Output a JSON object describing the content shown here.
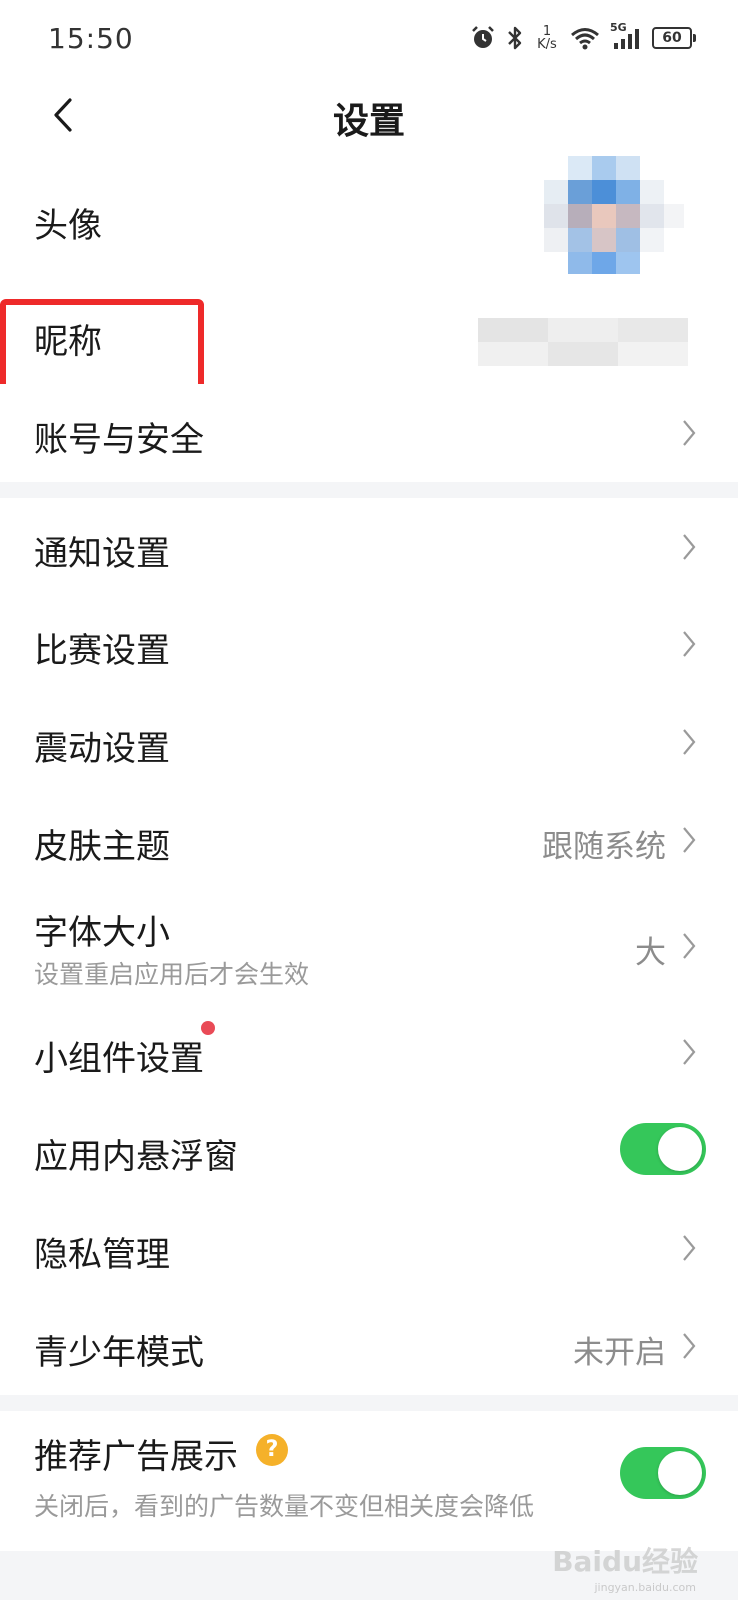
{
  "status_bar": {
    "time": "15:50",
    "net_speed_value": "1",
    "net_speed_unit": "K/s",
    "signal_label": "5G",
    "battery": "60"
  },
  "header": {
    "title": "设置",
    "back_icon": "chevron-left-icon"
  },
  "profile": {
    "avatar_label": "头像",
    "nickname_label": "昵称",
    "account_label": "账号与安全"
  },
  "settings": {
    "notification": "通知设置",
    "match": "比赛设置",
    "vibration": "震动设置",
    "theme": {
      "label": "皮肤主题",
      "value": "跟随系统"
    },
    "font_size": {
      "label": "字体大小",
      "hint": "设置重启应用后才会生效",
      "value": "大"
    },
    "widget": "小组件设置",
    "floating_window": {
      "label": "应用内悬浮窗",
      "enabled": true
    },
    "privacy": "隐私管理",
    "teen_mode": {
      "label": "青少年模式",
      "value": "未开启"
    }
  },
  "ads": {
    "label": "推荐广告展示",
    "help_icon": "?",
    "hint": "关闭后，看到的广告数量不变但相关度会降低",
    "enabled": true
  },
  "watermark": {
    "main": "Baidu经验",
    "sub": "jingyan.baidu.com"
  },
  "colors": {
    "toggle_on": "#35c75a",
    "highlight_box": "#ee2a2a",
    "notification_dot": "#e94a56",
    "help_icon": "#f5b12a"
  }
}
